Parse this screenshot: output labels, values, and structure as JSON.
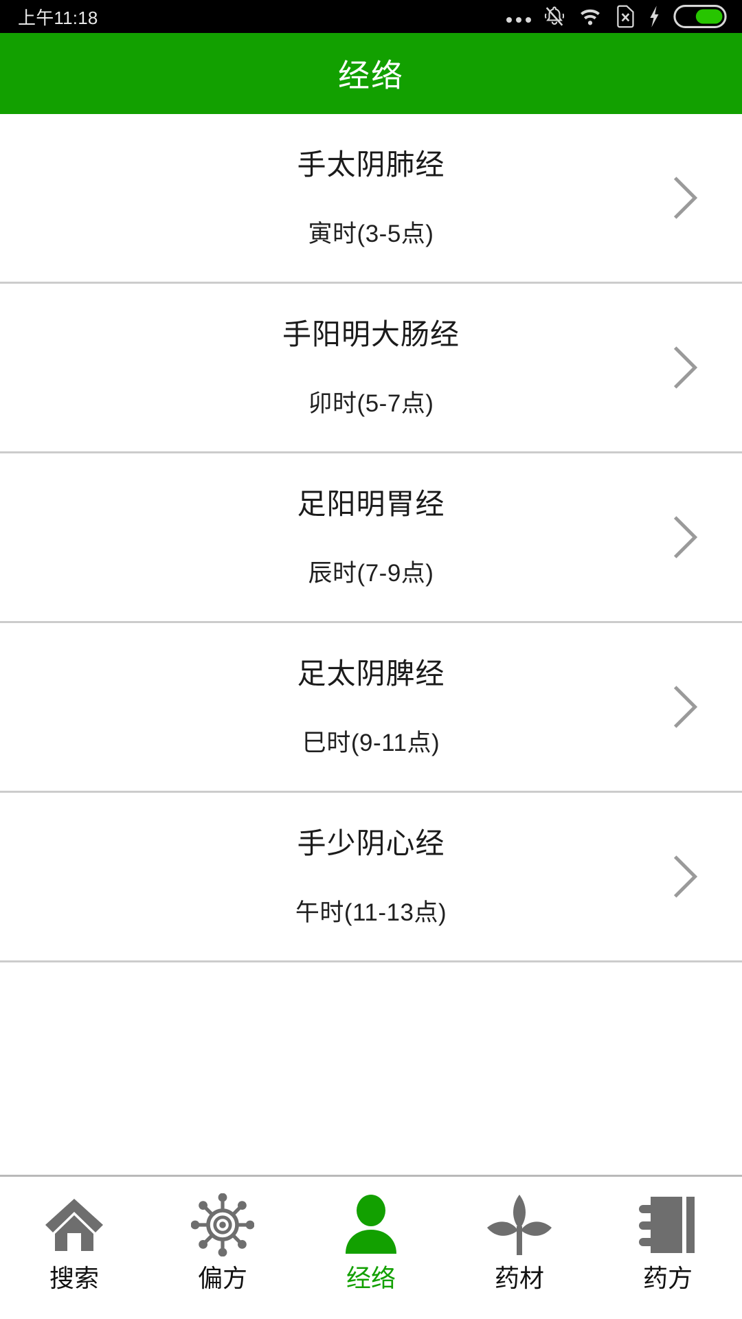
{
  "status_bar": {
    "time": "上午11:18",
    "icons": [
      "more-dots-icon",
      "bell-muted-icon",
      "wifi-icon",
      "no-sim-icon",
      "charging-bolt-icon",
      "battery-icon"
    ]
  },
  "header": {
    "title": "经络",
    "background_color": "#12a000",
    "text_color": "#ffffff"
  },
  "list": {
    "items": [
      {
        "title": "手太阴肺经",
        "subtitle": "寅时(3-5点)",
        "chevron": "chevron-right-icon"
      },
      {
        "title": "手阳明大肠经",
        "subtitle": "卯时(5-7点)",
        "chevron": "chevron-right-icon"
      },
      {
        "title": "足阳明胃经",
        "subtitle": "辰时(7-9点)",
        "chevron": "chevron-right-icon"
      },
      {
        "title": "足太阴脾经",
        "subtitle": "巳时(9-11点)",
        "chevron": "chevron-right-icon"
      },
      {
        "title": "手少阴心经",
        "subtitle": "午时(11-13点)",
        "chevron": "chevron-right-icon"
      }
    ]
  },
  "tabbar": {
    "active_index": 2,
    "active_color": "#12a000",
    "inactive_color": "#6e6e6e",
    "items": [
      {
        "label": "搜索",
        "icon": "home-icon"
      },
      {
        "label": "偏方",
        "icon": "virus-icon"
      },
      {
        "label": "经络",
        "icon": "person-icon"
      },
      {
        "label": "药材",
        "icon": "plant-leaf-icon"
      },
      {
        "label": "药方",
        "icon": "notebook-icon"
      }
    ]
  }
}
